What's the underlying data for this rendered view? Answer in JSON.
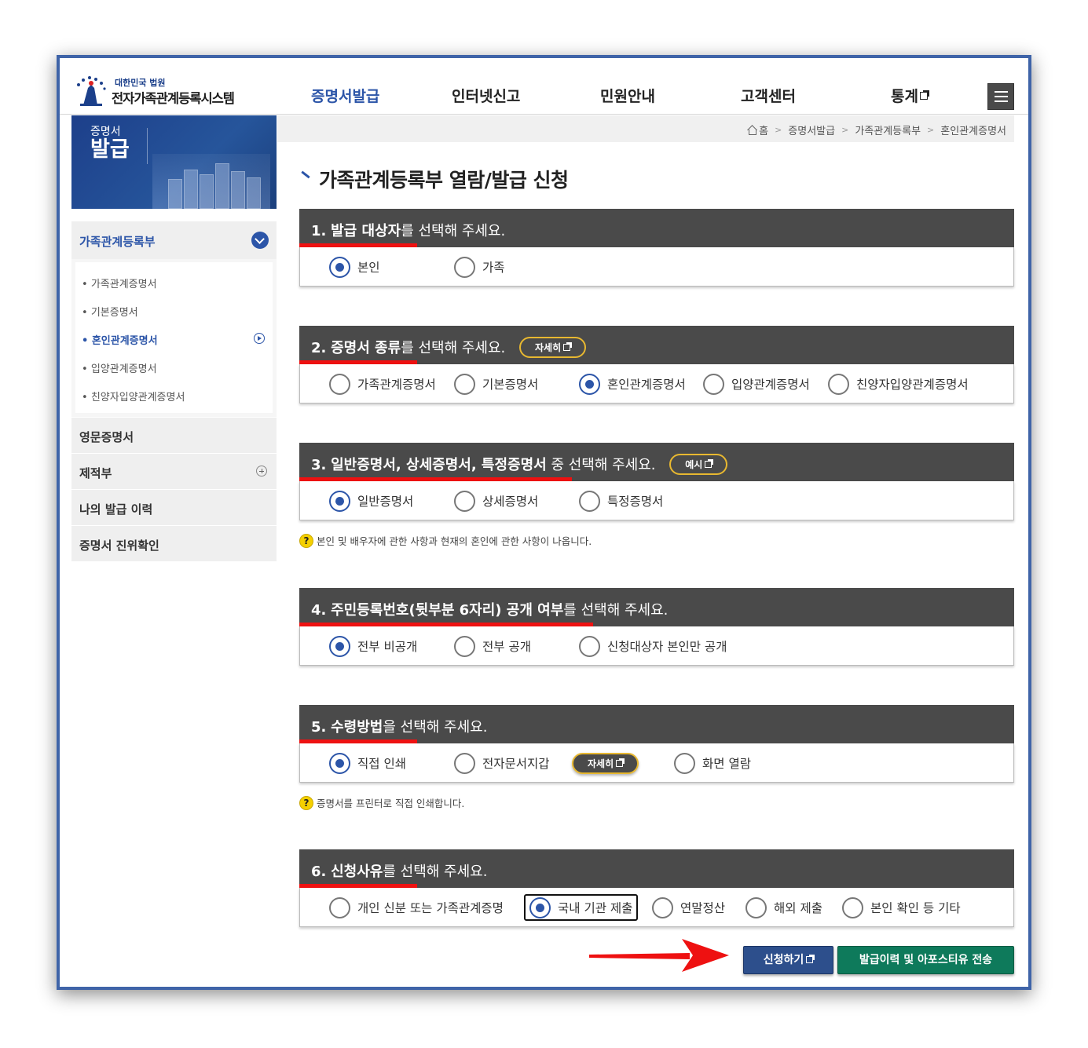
{
  "header": {
    "logo_top": "대한민국 법원",
    "logo_main": "전자가족관계등록시스템",
    "nav": [
      "증명서발급",
      "인터넷신고",
      "민원안내",
      "고객센터",
      "통계"
    ]
  },
  "banner": {
    "line1": "증명서",
    "line2": "발급"
  },
  "sidebar": {
    "group_title": "가족관계등록부",
    "sub_items": [
      "가족관계증명서",
      "기본증명서",
      "혼인관계증명서",
      "입양관계증명서",
      "친양자입양관계증명서"
    ],
    "items": [
      "영문증명서",
      "제적부",
      "나의 발급 이력",
      "증명서 진위확인"
    ]
  },
  "breadcrumb": [
    "홈",
    "증명서발급",
    "가족관계등록부",
    "혼인관계증명서"
  ],
  "page_title": "가족관계등록부 열람/발급 신청",
  "sections": [
    {
      "num": "1.",
      "highlight": "발급 대상자",
      "rest": "를 선택해 주세요.",
      "options": [
        "본인",
        "가족"
      ],
      "selected": "본인"
    },
    {
      "num": "2.",
      "highlight": "증명서 종류",
      "rest": "를 선택해 주세요.",
      "button": "자세히",
      "options": [
        "가족관계증명서",
        "기본증명서",
        "혼인관계증명서",
        "입양관계증명서",
        "친양자입양관계증명서"
      ],
      "selected": "혼인관계증명서"
    },
    {
      "num": "3.",
      "highlight": "일반증명서, 상세증명서, 특정증명서",
      "rest": " 중 선택해 주세요.",
      "button": "예시",
      "options": [
        "일반증명서",
        "상세증명서",
        "특정증명서"
      ],
      "selected": "일반증명서",
      "note": "본인 및 배우자에 관한 사항과 현재의 혼인에 관한 사항이 나옵니다."
    },
    {
      "num": "4.",
      "highlight": "주민등록번호(뒷부분 6자리) 공개 여부",
      "rest": "를 선택해 주세요.",
      "options": [
        "전부 비공개",
        "전부 공개",
        "신청대상자 본인만 공개"
      ],
      "selected": "전부 비공개"
    },
    {
      "num": "5.",
      "highlight": "수령방법",
      "rest": "을 선택해 주세요.",
      "options": [
        "직접 인쇄",
        "전자문서지갑",
        "화면 열람"
      ],
      "selected": "직접 인쇄",
      "inline_button": "자세히",
      "note": "증명서를 프린터로 직접 인쇄합니다."
    },
    {
      "num": "6.",
      "highlight": "신청사유",
      "rest": "를 선택해 주세요.",
      "options": [
        "개인 신분 또는 가족관계증명",
        "국내 기관 제출",
        "연말정산",
        "해외 제출",
        "본인 확인 등 기타"
      ],
      "selected": "국내 기관 제출"
    }
  ],
  "buttons": {
    "apply": "신청하기",
    "history": "발급이력 및 아포스티유 전송"
  },
  "colors": {
    "accent": "#2c55a8",
    "section_header": "#4a4a4a",
    "highlight_underline": "#ee1111",
    "apply_button": "#2d4f8c",
    "history_button": "#0e7a5b"
  }
}
